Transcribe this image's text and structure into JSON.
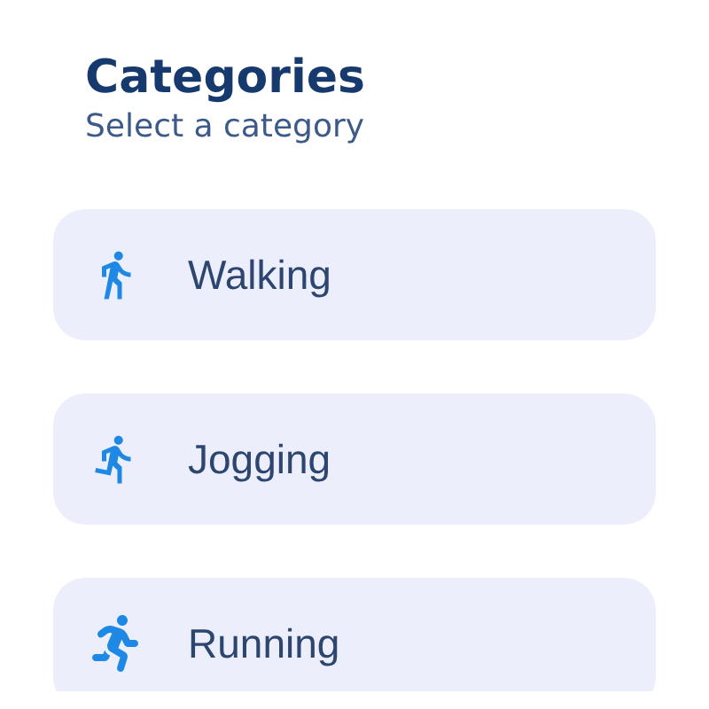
{
  "header": {
    "title": "Categories",
    "subtitle": "Select a category"
  },
  "categories": [
    {
      "kind": "walk",
      "label": "Walking"
    },
    {
      "kind": "jog",
      "label": "Jogging"
    },
    {
      "kind": "run",
      "label": "Running"
    }
  ]
}
